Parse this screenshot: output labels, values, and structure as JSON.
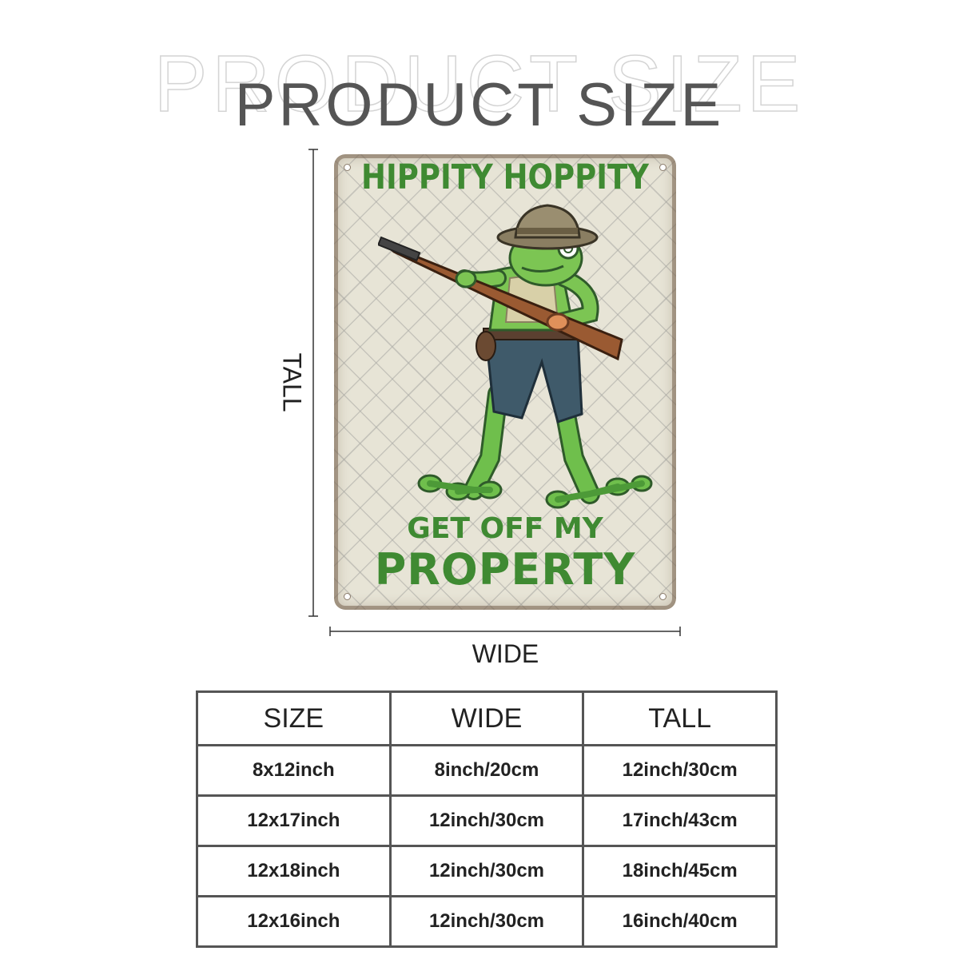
{
  "header": {
    "title": "PRODUCT SIZE"
  },
  "sign": {
    "top_text": "HIPPITY HOPPITY",
    "middle_text": "GET OFF MY",
    "bottom_text": "PROPERTY",
    "text_color": "#3f8a32",
    "background_color": "#e7e4d6"
  },
  "dimensions": {
    "tall_label": "TALL",
    "wide_label": "WIDE"
  },
  "size_table": {
    "columns": [
      "SIZE",
      "WIDE",
      "TALL"
    ],
    "rows": [
      [
        "8x12inch",
        "8inch/20cm",
        "12inch/30cm"
      ],
      [
        "12x17inch",
        "12inch/30cm",
        "17inch/43cm"
      ],
      [
        "12x18inch",
        "12inch/30cm",
        "18inch/45cm"
      ],
      [
        "12x16inch",
        "12inch/30cm",
        "16inch/40cm"
      ]
    ]
  }
}
